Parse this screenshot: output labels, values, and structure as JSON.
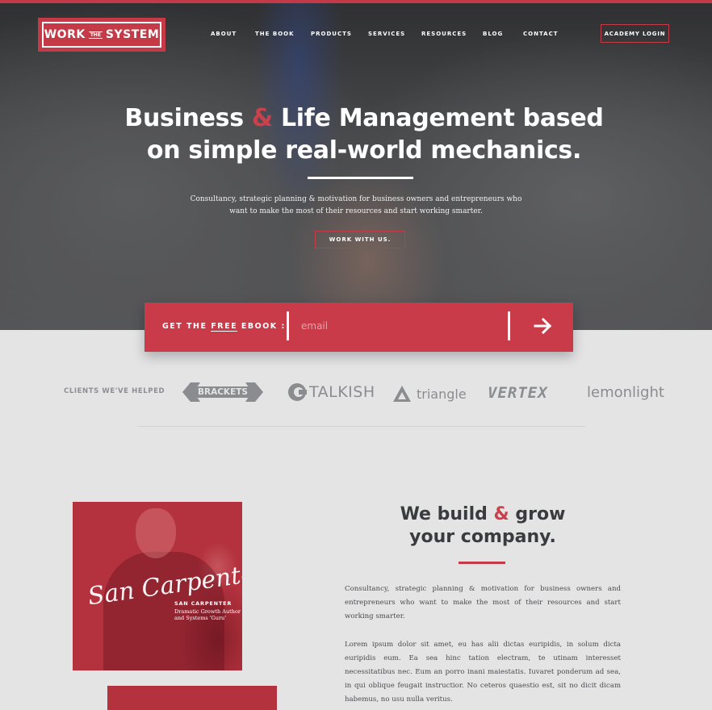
{
  "colors": {
    "accent": "#c43a46",
    "ebook_bg": "#c93b48",
    "page_bg": "#e4e4e5",
    "text_dark": "#3a3b3e",
    "client_grey": "#8b8c8f"
  },
  "logo": {
    "left": "WORK",
    "middle": "THE",
    "right": "SYSTEM"
  },
  "nav": {
    "items": [
      "ABOUT",
      "THE BOOK",
      "PRODUCTS",
      "SERVICES",
      "RESOURCES",
      "BLOG",
      "CONTACT"
    ],
    "login": "ACADEMY LOGIN"
  },
  "hero": {
    "headline_part1": "Business ",
    "headline_amp": "&",
    "headline_part2": " Life Management based",
    "headline_line2": "on simple real-world mechanics.",
    "subtitle": "Consultancy, strategic planning & motivation for business owners and entrepreneurs who want to make the most of their resources and start working smarter.",
    "cta": "WORK WITH US."
  },
  "ebook": {
    "label_before": "GET THE ",
    "label_free": "FREE",
    "label_after": " EBOOK :",
    "placeholder": "email",
    "submit_icon": "arrow-right-icon"
  },
  "clients": {
    "label": "CLIENTS WE'VE HELPED",
    "logos": [
      "BRACKETS",
      "TALKISH",
      "triangle",
      "VERTEX",
      "lemonlight"
    ]
  },
  "about": {
    "signature": "San Carpenter",
    "name": "SAN CARPENTER",
    "role": "Dramatic Growth Author and Systems 'Guru'",
    "title_part1": "We build ",
    "title_amp": "&",
    "title_part2": " grow",
    "title_line2": "your company.",
    "paragraph1": "Consultancy, strategic planning & motivation for business owners and entrepreneurs who want to make the most of their resources and start working smarter.",
    "paragraph2": "Lorem ipsum dolor sit amet, eu has alii dictas euripidis, in solum dicta euripidis eum. Ea sea hinc tation electram, te utinam interesset necessitatibus nec. Eum an porro inani maiestatis. Iuvaret ponderum ad sea, in qui oblique feugait instructior. No ceteros quaestio est, sit no dicit dicam habemus, no usu nulla veritus."
  }
}
